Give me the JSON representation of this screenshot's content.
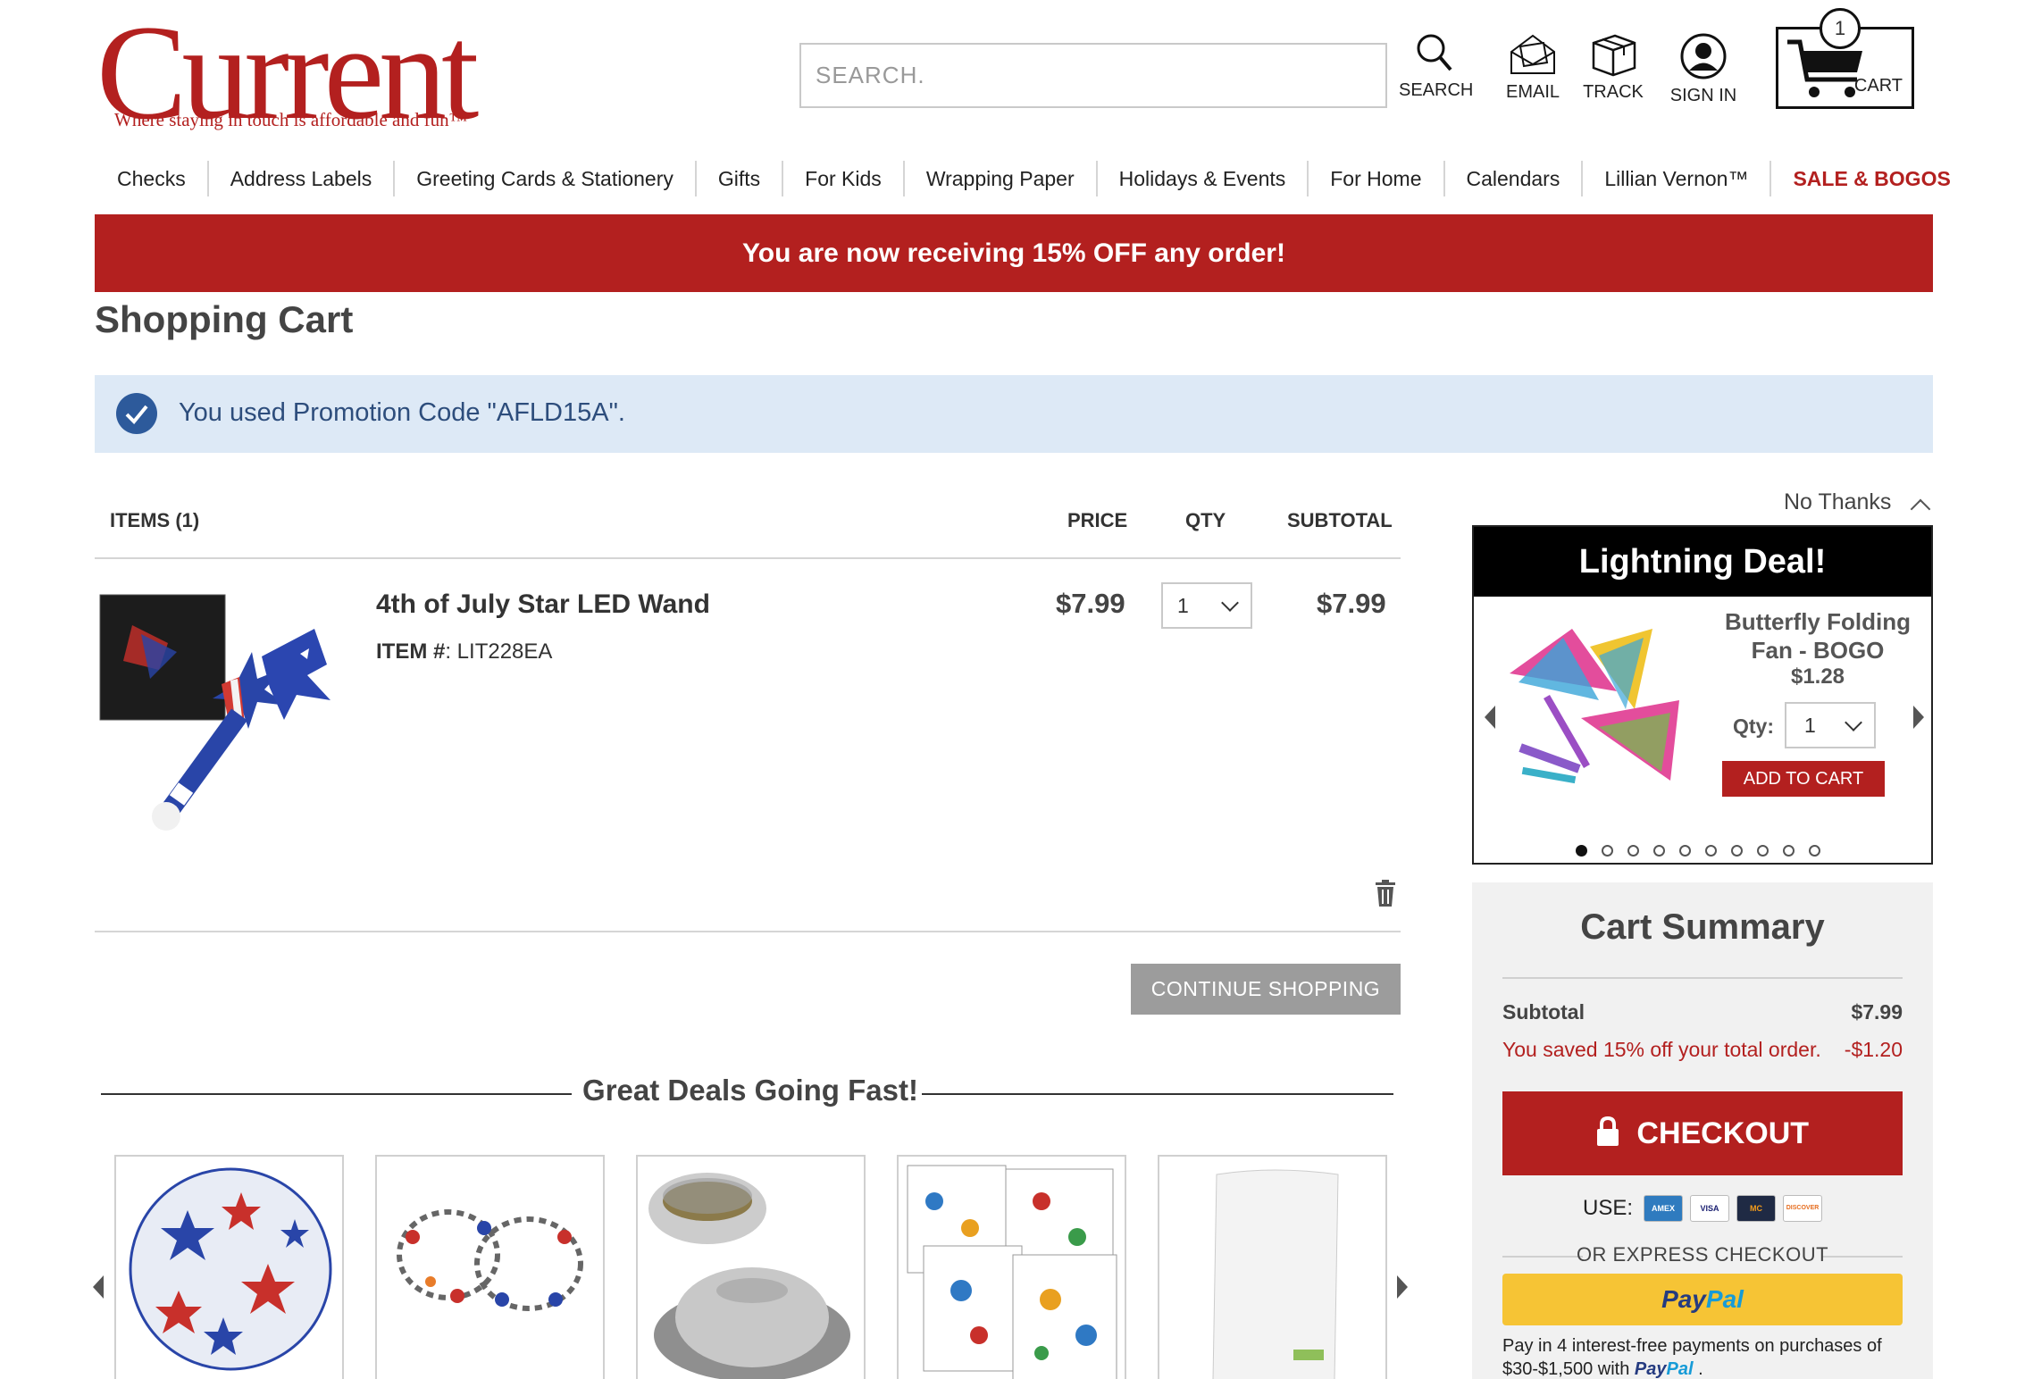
{
  "brand": {
    "name": "Current",
    "tagline": "Where staying in touch is affordable and fun™",
    "color": "#b3201f"
  },
  "header": {
    "search_placeholder": "SEARCH.",
    "search_label": "SEARCH",
    "email_label": "EMAIL",
    "track_label": "TRACK",
    "signin_label": "SIGN IN",
    "cart_label": "CART",
    "cart_count": "1"
  },
  "nav": [
    "Checks",
    "Address Labels",
    "Greeting Cards & Stationery",
    "Gifts",
    "For Kids",
    "Wrapping Paper",
    "Holidays & Events",
    "For Home",
    "Calendars",
    "Lillian Vernon™",
    "SALE & BOGOS"
  ],
  "promo_banner": "You are now receiving 15% OFF any order!",
  "page_title": "Shopping Cart",
  "promo_message": "You used Promotion Code \"AFLD15A\".",
  "cart": {
    "headers": {
      "items": "ITEMS (1)",
      "price": "PRICE",
      "qty": "QTY",
      "subtotal": "SUBTOTAL"
    },
    "items": [
      {
        "name": "4th of July Star LED Wand",
        "item_label": "ITEM #",
        "item_number": ": LIT228EA",
        "price": "$7.99",
        "qty": "1",
        "subtotal": "$7.99"
      }
    ],
    "continue_label": "CONTINUE SHOPPING"
  },
  "deals": {
    "title": "Great Deals Going Fast!",
    "count": 5
  },
  "lightning_deal": {
    "no_thanks": "No Thanks",
    "title": "Lightning Deal!",
    "product_name": "Butterfly Folding Fan - BOGO",
    "price": "$1.28",
    "qty_label": "Qty:",
    "qty": "1",
    "add_label": "ADD TO CART",
    "dots_total": 10,
    "dots_active": 1
  },
  "summary": {
    "title": "Cart Summary",
    "subtotal_label": "Subtotal",
    "subtotal_value": "$7.99",
    "saved_label": "You saved 15% off your total order.",
    "saved_value": "-$1.20",
    "saved_color": "#b3201f",
    "checkout_label": "CHECKOUT",
    "use_label": "USE:",
    "cards": [
      "AMEX",
      "VISA",
      "MC",
      "DISCOVER"
    ],
    "express_label": "OR EXPRESS CHECKOUT",
    "paypal_a": "Pay",
    "paypal_b": "Pal",
    "pay4_text": "Pay in 4 interest-free payments on purchases of $30-$1,500 with",
    "pay4_suffix": "."
  }
}
